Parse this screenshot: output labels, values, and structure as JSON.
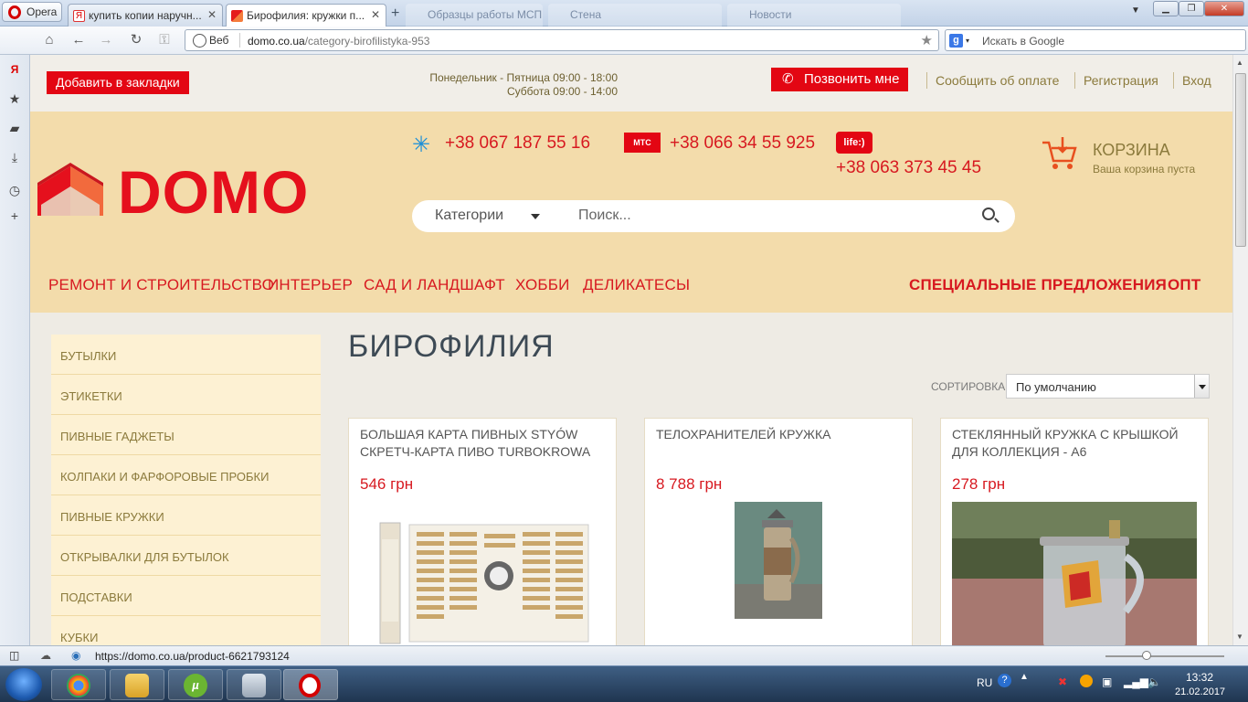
{
  "browser": {
    "menu_label": "Opera",
    "tabs": [
      {
        "label": "купить копии наручн..."
      },
      {
        "label": "Бирофилия: кружки п..."
      }
    ],
    "ghost_tabs": [
      "Образцы работы МСП",
      "Стена",
      "Новости"
    ],
    "web_label": "Веб",
    "url_domain": "domo.co.ua",
    "url_path": "/category-birofilistyka-953",
    "search_placeholder": "Искать в Google",
    "status_url": "https://domo.co.ua/product-6621793124"
  },
  "site": {
    "bookmark_label": "Добавить в закладки",
    "hours_weekdays": "Понедельник - Пятница 09:00 - 18:00",
    "hours_saturday": "Суббота 09:00 - 14:00",
    "callback_label": "Позвонить мне",
    "top_links": [
      "Сообщить об оплате",
      "Регистрация",
      "Вход"
    ],
    "logo_text": "DOMO",
    "phones": {
      "kyivstar": "+38 067 187 55 16",
      "mts": "+38 066 34 55 925",
      "life": "+38 063 373 45 45",
      "mts_logo": "МТС",
      "life_logo": "life:)"
    },
    "cart": {
      "title": "КОРЗИНА",
      "subtitle": "Ваша корзина пуста"
    },
    "search": {
      "category_label": "Категории",
      "placeholder": "Поиск..."
    },
    "menu": [
      "РЕМОНТ И СТРОИТЕЛЬСТВО",
      "ИНТЕРЬЕР",
      "САД И ЛАНДШАФТ",
      "ХОББИ",
      "ДЕЛИКАТЕСЫ"
    ],
    "menu_right": [
      "СПЕЦИАЛЬНЫЕ ПРЕДЛОЖЕНИЯ",
      "ОПТ"
    ],
    "sidebar": [
      "БУТЫЛКИ",
      "ЭТИКЕТКИ",
      "ПИВНЫЕ ГАДЖЕТЫ",
      "КОЛПАКИ И ФАРФОРОВЫЕ ПРОБКИ",
      "ПИВНЫЕ КРУЖКИ",
      "ОТКРЫВАЛКИ ДЛЯ БУТЫЛОК",
      "ПОДСТАВКИ",
      "КУБКИ"
    ],
    "page_title": "БИРОФИЛИЯ",
    "sort_label": "СОРТИРОВКА:",
    "sort_value": "По умолчанию",
    "products": [
      {
        "name": "Большая карта пивных Styów скретч-карта пиво Turbokrowa",
        "price": "546 грн"
      },
      {
        "name": "Телохранителей кружка",
        "price": "8 788 грн"
      },
      {
        "name": "Стеклянный кружка с крышкой для коллекция - A6",
        "price": "278 грн"
      }
    ]
  },
  "taskbar": {
    "lang": "RU",
    "time": "13:32",
    "date": "21.02.2017"
  },
  "colors": {
    "brand_red": "#e30613",
    "header_bg": "#f3dcab",
    "sidebar_bg": "#fdf1d3"
  }
}
